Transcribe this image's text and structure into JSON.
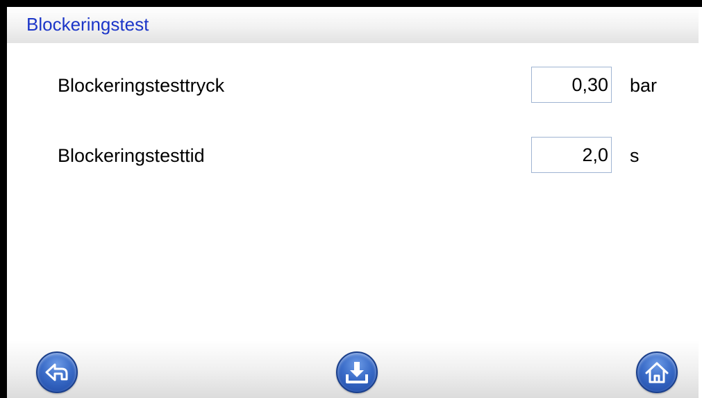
{
  "header": {
    "title": "Blockeringstest"
  },
  "parameters": [
    {
      "label": "Blockeringstesttryck",
      "value": "0,30",
      "unit": "bar"
    },
    {
      "label": "Blockeringstesttid",
      "value": "2,0",
      "unit": "s"
    }
  ],
  "toolbar": {
    "back_icon": "back-arrow-icon",
    "save_icon": "download-icon",
    "home_icon": "home-icon"
  },
  "colors": {
    "title": "#1c36c8",
    "button": "#3a6cc8"
  }
}
